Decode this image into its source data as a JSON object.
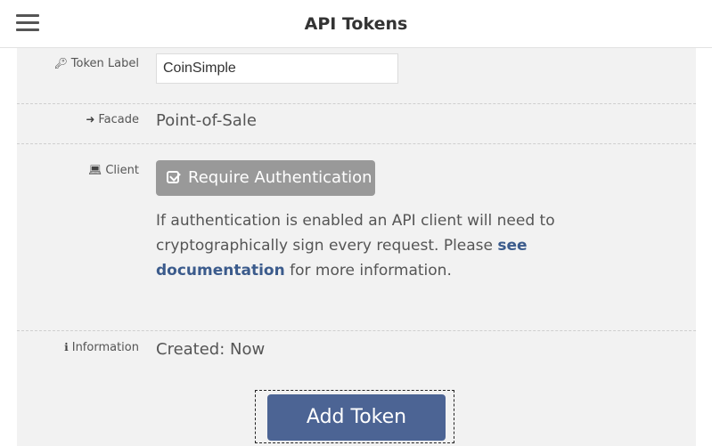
{
  "header": {
    "title": "API Tokens",
    "menu_icon": "hamburger-menu-icon"
  },
  "form": {
    "token_label": {
      "icon": "key-icon",
      "label": "Token Label",
      "value": "CoinSimple"
    },
    "facade": {
      "icon": "sign-in-icon",
      "label": "Facade",
      "value": "Point-of-Sale"
    },
    "client": {
      "icon": "laptop-icon",
      "label": "Client",
      "button_label": "Require Authentication",
      "help_before": "If authentication is enabled an API client will need to cryptographically sign every request. Please ",
      "help_link": "see documentation",
      "help_after": " for more information."
    },
    "information": {
      "icon": "info-circle-icon",
      "label": "Information",
      "value": "Created: Now"
    },
    "submit_label": "Add Token"
  },
  "colors": {
    "primary_button": "#4c6494",
    "link": "#3b5b8c",
    "toggle_button": "#999999",
    "panel_bg": "#f2f2f2"
  }
}
